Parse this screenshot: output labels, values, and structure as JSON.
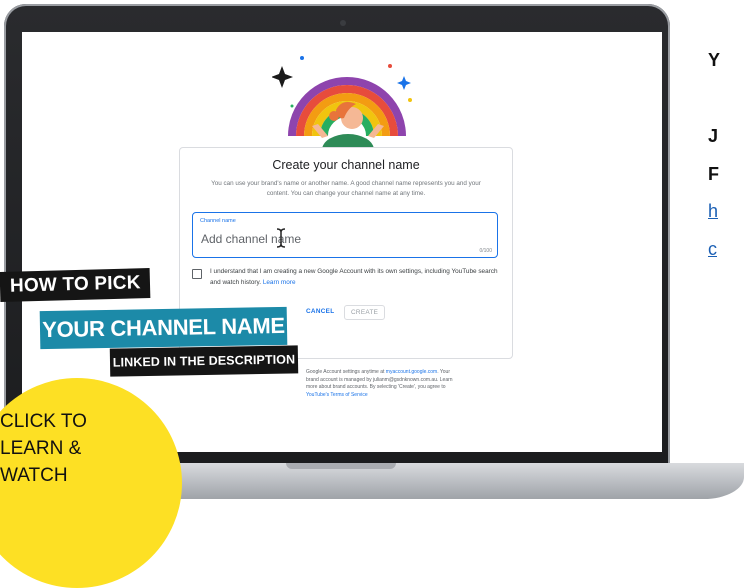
{
  "dialog": {
    "title": "Create your channel name",
    "description": "You can use your brand's name or another name. A good channel name represents you and your content. You can change your channel name at any time.",
    "field_label": "Channel name",
    "field_placeholder": "Add channel name",
    "char_count": "0/100",
    "consent_text": "I understand that I am creating a new Google Account with its own settings, including YouTube search and watch history.",
    "consent_link": "Learn more",
    "cancel_label": "CANCEL",
    "create_label": "CREATE"
  },
  "footer": {
    "line1_pre": "Google Account settings anytime at",
    "line1_link": "myaccount.google.com",
    "line1_post": ". Your",
    "line2": "brand account is managed by julianm@gsdnknown.com.au. Learn",
    "line3": "more about brand accounts. By selecting 'Create', you agree to",
    "line4_link": "YouTube's Terms of Service"
  },
  "overlay": {
    "how_to_pick": "HOW TO PICK",
    "channel_name": "YOUR CHANNEL NAME",
    "linked": "LINKED IN THE DESCRIPTION",
    "cta": [
      "CLICK TO",
      "LEARN &",
      "WATCH"
    ]
  },
  "right_column": {
    "line1": "Y",
    "line2": "J",
    "line3": "F",
    "line4": "h",
    "line5": "c"
  },
  "colors": {
    "accent_blue": "#1a73e8",
    "banner_teal": "#1c8aa8",
    "cta_yellow": "#fde024",
    "banner_black": "#151515"
  },
  "icons": [
    "rainbow-illustration",
    "text-cursor-icon",
    "checkbox"
  ]
}
